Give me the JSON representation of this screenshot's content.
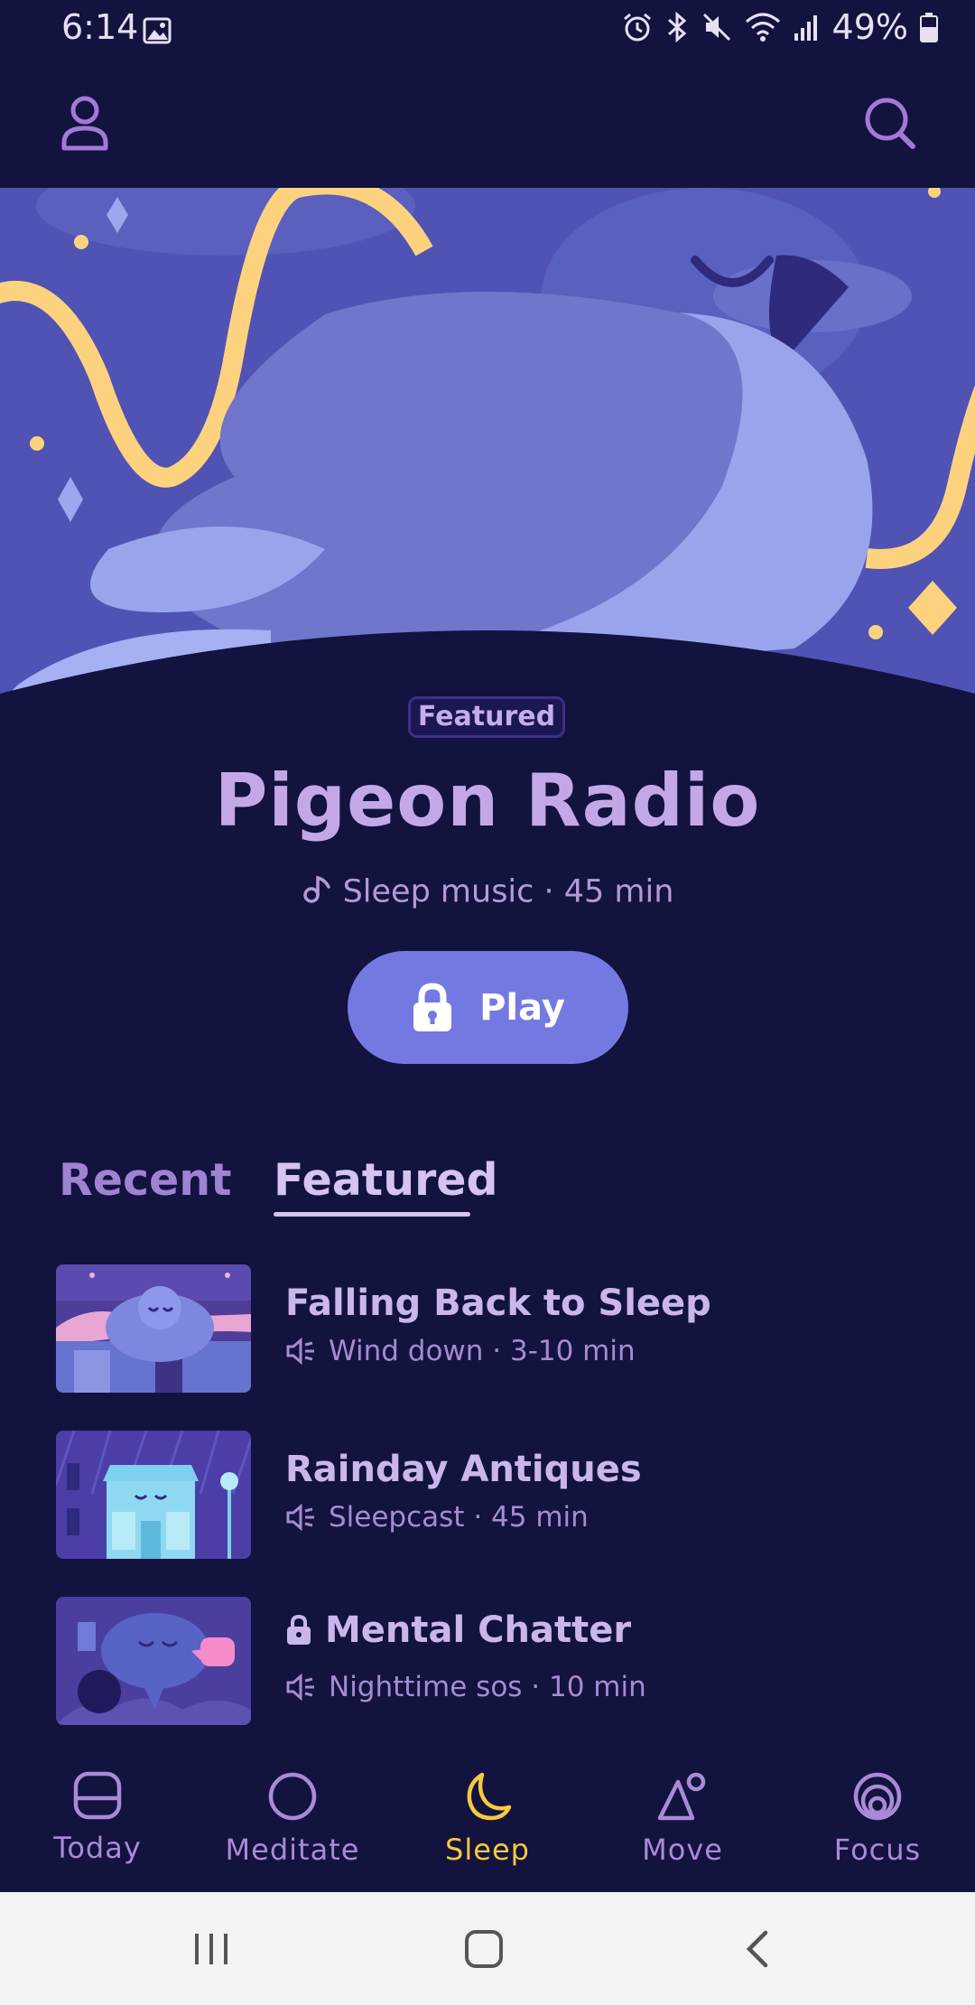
{
  "status_bar": {
    "time": "6:14",
    "battery": "49%"
  },
  "hero": {
    "badge": "Featured",
    "title": "Pigeon Radio",
    "meta": "Sleep music · 45 min",
    "play_label": "Play"
  },
  "tabs": [
    {
      "label": "Recent",
      "active": false
    },
    {
      "label": "Featured",
      "active": true
    }
  ],
  "list": [
    {
      "title": "Falling Back to Sleep",
      "meta": "Wind down · 3-10 min",
      "locked": false
    },
    {
      "title": "Rainday Antiques",
      "meta": "Sleepcast · 45 min",
      "locked": false
    },
    {
      "title": "Mental Chatter",
      "meta": "Nighttime sos · 10 min",
      "locked": true
    }
  ],
  "bottom_nav": [
    {
      "label": "Today",
      "icon": "today-icon",
      "active": false
    },
    {
      "label": "Meditate",
      "icon": "meditate-icon",
      "active": false
    },
    {
      "label": "Sleep",
      "icon": "moon-icon",
      "active": true
    },
    {
      "label": "Move",
      "icon": "move-icon",
      "active": false
    },
    {
      "label": "Focus",
      "icon": "focus-icon",
      "active": false
    }
  ],
  "colors": {
    "background": "#12133f",
    "accent_button": "#7479e2",
    "active_nav": "#f7c93b",
    "text_primary": "#c4a8e6"
  }
}
